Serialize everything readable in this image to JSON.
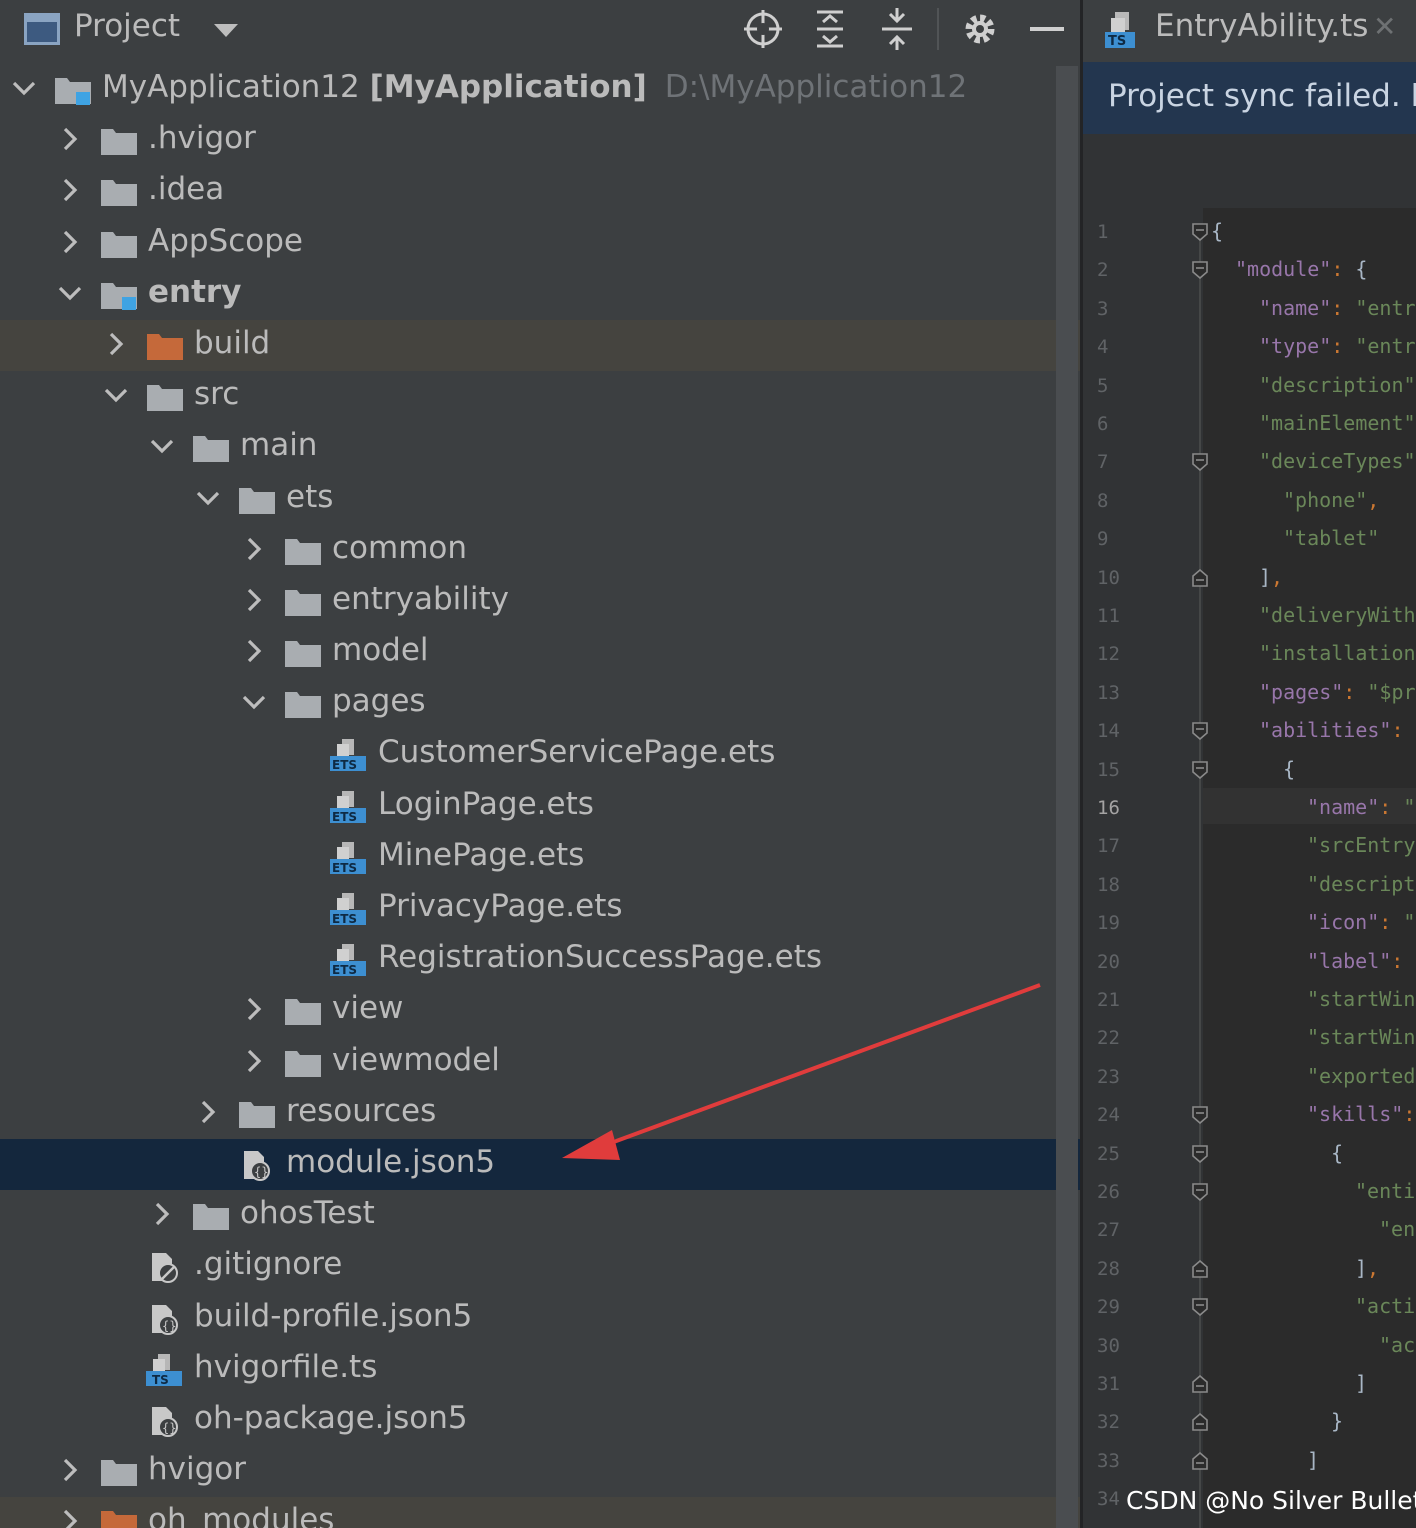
{
  "project_panel": {
    "title": "Project",
    "toolbar_icons": [
      "locate-icon",
      "expand-all-icon",
      "collapse-all-icon",
      "gear-icon",
      "hide-icon"
    ]
  },
  "tree": [
    {
      "label": "MyApplication12",
      "extra": "[MyApplication]",
      "path": "D:\\MyApplication12",
      "level": 0,
      "expanded": true,
      "kind": "module-folder"
    },
    {
      "label": ".hvigor",
      "level": 1,
      "expanded": false,
      "kind": "folder"
    },
    {
      "label": ".idea",
      "level": 1,
      "expanded": false,
      "kind": "folder"
    },
    {
      "label": "AppScope",
      "level": 1,
      "expanded": false,
      "kind": "folder"
    },
    {
      "label": "entry",
      "level": 1,
      "expanded": true,
      "kind": "module-folder",
      "bold": true
    },
    {
      "label": "build",
      "level": 2,
      "expanded": false,
      "kind": "excluded-folder",
      "band": true
    },
    {
      "label": "src",
      "level": 2,
      "expanded": true,
      "kind": "folder"
    },
    {
      "label": "main",
      "level": 3,
      "expanded": true,
      "kind": "folder"
    },
    {
      "label": "ets",
      "level": 4,
      "expanded": true,
      "kind": "folder"
    },
    {
      "label": "common",
      "level": 5,
      "expanded": false,
      "kind": "folder"
    },
    {
      "label": "entryability",
      "level": 5,
      "expanded": false,
      "kind": "folder"
    },
    {
      "label": "model",
      "level": 5,
      "expanded": false,
      "kind": "folder"
    },
    {
      "label": "pages",
      "level": 5,
      "expanded": true,
      "kind": "folder"
    },
    {
      "label": "CustomerServicePage.ets",
      "level": 6,
      "kind": "ets-file"
    },
    {
      "label": "LoginPage.ets",
      "level": 6,
      "kind": "ets-file"
    },
    {
      "label": "MinePage.ets",
      "level": 6,
      "kind": "ets-file"
    },
    {
      "label": "PrivacyPage.ets",
      "level": 6,
      "kind": "ets-file"
    },
    {
      "label": "RegistrationSuccessPage.ets",
      "level": 6,
      "kind": "ets-file"
    },
    {
      "label": "view",
      "level": 5,
      "expanded": false,
      "kind": "folder"
    },
    {
      "label": "viewmodel",
      "level": 5,
      "expanded": false,
      "kind": "folder"
    },
    {
      "label": "resources",
      "level": 4,
      "expanded": false,
      "kind": "folder"
    },
    {
      "label": "module.json5",
      "level": 4,
      "kind": "json-file",
      "selected": true
    },
    {
      "label": "ohosTest",
      "level": 3,
      "expanded": false,
      "kind": "folder"
    },
    {
      "label": ".gitignore",
      "level": 2,
      "kind": "ignore-file"
    },
    {
      "label": "build-profile.json5",
      "level": 2,
      "kind": "json-file"
    },
    {
      "label": "hvigorfile.ts",
      "level": 2,
      "kind": "ts-file"
    },
    {
      "label": "oh-package.json5",
      "level": 2,
      "kind": "json-file"
    },
    {
      "label": "hvigor",
      "level": 1,
      "expanded": false,
      "kind": "folder"
    },
    {
      "label": "oh_modules",
      "level": 1,
      "expanded": false,
      "kind": "excluded-folder",
      "band": true
    }
  ],
  "editor": {
    "tab_label": "EntryAbility.ts",
    "banner": "Project sync failed. Ba",
    "current_line": 16,
    "lines": [
      {
        "n": "1",
        "text": "{"
      },
      {
        "n": "2",
        "text": "\"module\": {"
      },
      {
        "n": "3",
        "text": "\"name\": \"entry"
      },
      {
        "n": "4",
        "text": "\"type\": \"entry"
      },
      {
        "n": "5",
        "text": "\"description\""
      },
      {
        "n": "6",
        "text": "\"mainElement\""
      },
      {
        "n": "7",
        "text": "\"deviceTypes\""
      },
      {
        "n": "8",
        "text": "\"phone\","
      },
      {
        "n": "9",
        "text": "\"tablet\""
      },
      {
        "n": "10",
        "text": "],"
      },
      {
        "n": "11",
        "text": "\"deliveryWith"
      },
      {
        "n": "12",
        "text": "\"installation"
      },
      {
        "n": "13",
        "text": "\"pages\": \"$pro"
      },
      {
        "n": "14",
        "text": "\"abilities\":"
      },
      {
        "n": "15",
        "text": "{"
      },
      {
        "n": "16",
        "text": "\"name\": \""
      },
      {
        "n": "17",
        "text": "\"srcEntry"
      },
      {
        "n": "18",
        "text": "\"descript"
      },
      {
        "n": "19",
        "text": "\"icon\": \""
      },
      {
        "n": "20",
        "text": "\"label\":"
      },
      {
        "n": "21",
        "text": "\"startWin"
      },
      {
        "n": "22",
        "text": "\"startWin"
      },
      {
        "n": "23",
        "text": "\"exported"
      },
      {
        "n": "24",
        "text": "\"skills\":"
      },
      {
        "n": "25",
        "text": "{"
      },
      {
        "n": "26",
        "text": "\"enti"
      },
      {
        "n": "27",
        "text": "\"en"
      },
      {
        "n": "28",
        "text": "],"
      },
      {
        "n": "29",
        "text": "\"acti"
      },
      {
        "n": "30",
        "text": "\"ac"
      },
      {
        "n": "31",
        "text": "]"
      },
      {
        "n": "32",
        "text": "}"
      },
      {
        "n": "33",
        "text": "]"
      },
      {
        "n": "34",
        "text": ""
      }
    ]
  },
  "watermark": "CSDN @No Silver Bullet",
  "colors": {
    "panel_bg": "#3c3f41",
    "selection": "#14273d",
    "excluded_band": "#45443f",
    "excluded_folder": "#c5693a",
    "annotation_arrow": "#e03c3c",
    "editor_bg": "#2b2b2b",
    "banner_bg": "#23364f"
  }
}
